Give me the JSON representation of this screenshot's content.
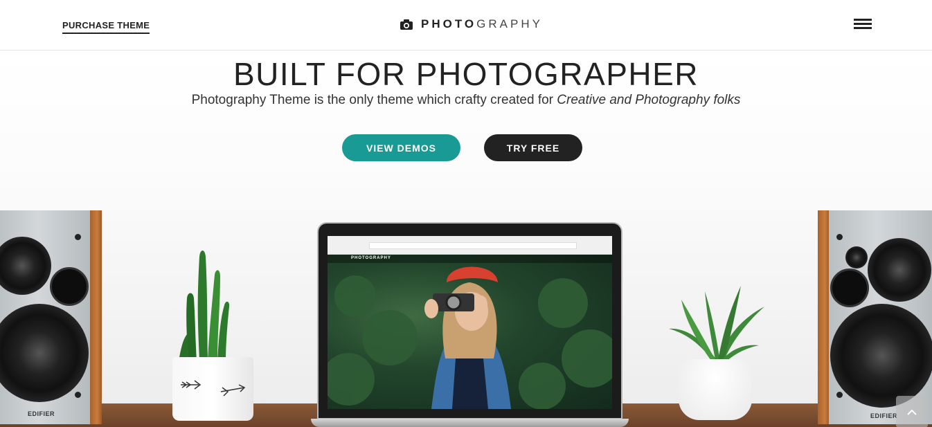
{
  "header": {
    "purchase_label": "PURCHASE THEME",
    "logo_bold": "PHOTO",
    "logo_light": "GRAPHY",
    "menu_icon": "hamburger-icon"
  },
  "hero": {
    "title": "BUILT FOR PHOTOGRAPHER",
    "subtitle_plain": "Photography Theme is the only theme which crafty created for ",
    "subtitle_italic": "Creative and Photography folks",
    "primary_button": "VIEW DEMOS",
    "secondary_button": "TRY FREE"
  },
  "scene": {
    "speaker_brand_left": "EDIFIER",
    "speaker_brand_right": "EDIFIER",
    "laptop_logo": "PHOTOGRAPHY"
  },
  "colors": {
    "accent": "#1a9a95",
    "dark_button": "#222222"
  }
}
